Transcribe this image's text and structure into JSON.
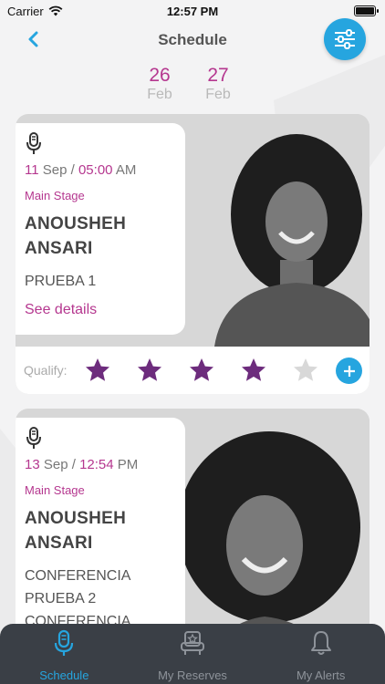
{
  "status_bar": {
    "carrier": "Carrier",
    "time": "12:57 PM"
  },
  "header": {
    "title": "Schedule"
  },
  "dates": [
    {
      "day": "26",
      "month": "Feb"
    },
    {
      "day": "27",
      "month": "Feb"
    }
  ],
  "events": [
    {
      "day": "11",
      "month": "Sep",
      "separator": "/",
      "time": "05:00",
      "ampm": "AM",
      "stage": "Main Stage",
      "speaker_first": "ANOUSHEH",
      "speaker_last": "ANSARI",
      "talk_lines": [
        "PRUEBA 1"
      ],
      "see_details": "See details",
      "qualify_label": "Qualify:",
      "rating": 4,
      "rating_max": 5
    },
    {
      "day": "13",
      "month": "Sep",
      "separator": "/",
      "time": "12:54",
      "ampm": "PM",
      "stage": "Main Stage",
      "speaker_first": "ANOUSHEH",
      "speaker_last": "ANSARI",
      "talk_lines": [
        "CONFERENCIA",
        "PRUEBA 2",
        "CONFERENCIA"
      ]
    }
  ],
  "tabs": [
    {
      "label": "Schedule",
      "icon": "microphone-icon",
      "active": true
    },
    {
      "label": "My Reserves",
      "icon": "reserve-chair-icon",
      "active": false
    },
    {
      "label": "My Alerts",
      "icon": "bell-icon",
      "active": false
    }
  ],
  "colors": {
    "accent": "#26a5df",
    "magenta": "#b5378f",
    "star_filled": "#6d2c7d",
    "star_empty": "#d8d8d8",
    "tab_bar": "#3a3f46"
  }
}
